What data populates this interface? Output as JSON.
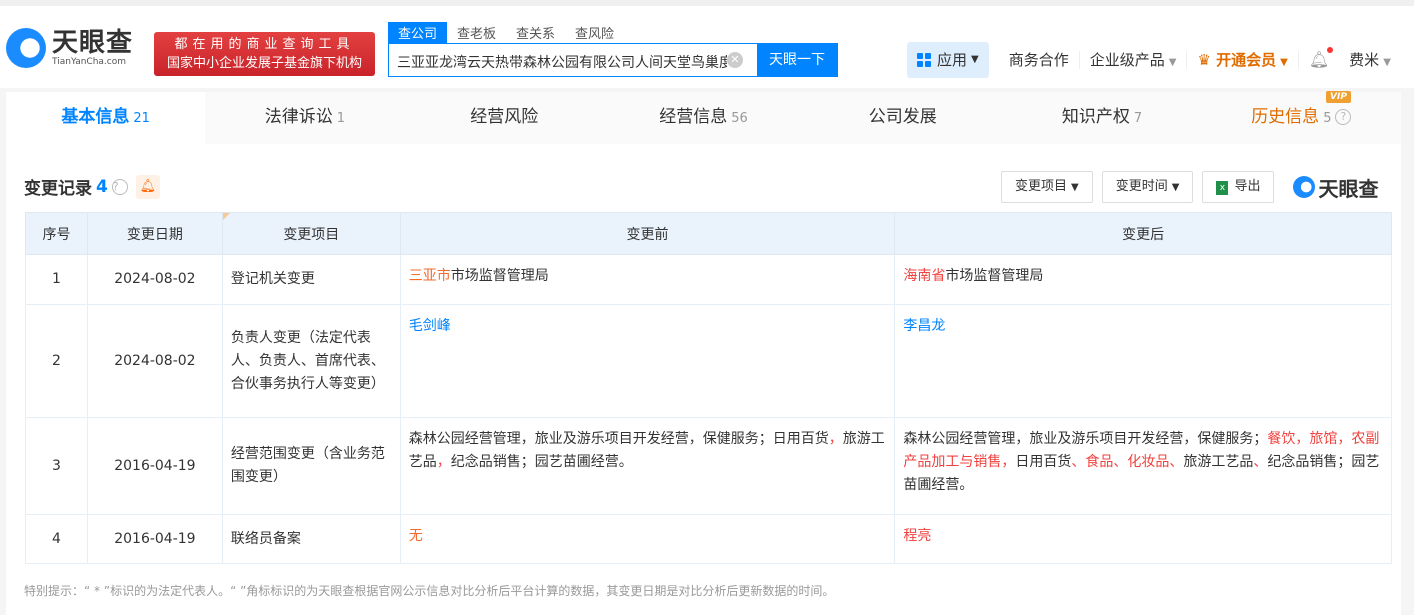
{
  "header": {
    "logo_text": "天眼查",
    "logo_domain": "TianYanCha.com",
    "slogan_line1": "都在用的商业查询工具",
    "slogan_line2": "国家中小企业发展子基金旗下机构",
    "search_tabs": [
      "查公司",
      "查老板",
      "查关系",
      "查风险"
    ],
    "search_value": "三亚亚龙湾云天热带森林公园有限公司人间天堂鸟巢度",
    "search_button": "天眼一下",
    "nav": {
      "app": "应用",
      "business": "商务合作",
      "enterprise": "企业级产品",
      "vip": "开通会员",
      "user": "费米"
    }
  },
  "tabs": [
    {
      "label": "基本信息",
      "count": "21"
    },
    {
      "label": "法律诉讼",
      "count": "1"
    },
    {
      "label": "经营风险",
      "count": ""
    },
    {
      "label": "经营信息",
      "count": "56"
    },
    {
      "label": "公司发展",
      "count": ""
    },
    {
      "label": "知识产权",
      "count": "7"
    },
    {
      "label": "历史信息",
      "count": "5",
      "badge": "VIP"
    }
  ],
  "section": {
    "title": "变更记录",
    "count": "4",
    "filter_item": "变更项目",
    "filter_time": "变更时间",
    "export": "导出",
    "brand": "天眼查"
  },
  "table": {
    "headers": [
      "序号",
      "变更日期",
      "变更项目",
      "变更前",
      "变更后"
    ],
    "rows": [
      {
        "no": "1",
        "date": "2024-08-02",
        "item": "登记机关变更",
        "before": [
          {
            "t": "三亚市",
            "c": "orange"
          },
          {
            "t": "市场监督管理局"
          }
        ],
        "after": [
          {
            "t": "海南省",
            "c": "red"
          },
          {
            "t": "市场监督管理局"
          }
        ]
      },
      {
        "no": "2",
        "date": "2024-08-02",
        "item": "负责人变更（法定代表人、负责人、首席代表、合伙事务执行人等变更）",
        "before": [
          {
            "t": "毛剑峰",
            "c": "blue"
          }
        ],
        "after": [
          {
            "t": "李昌龙",
            "c": "blue"
          }
        ]
      },
      {
        "no": "3",
        "date": "2016-04-19",
        "item": "经营范围变更（含业务范围变更）",
        "before": [
          {
            "t": "森林公园经营管理，旅业及游乐项目开发经营，保健服务；日用百货"
          },
          {
            "t": "，",
            "c": "red"
          },
          {
            "t": "旅游工艺品"
          },
          {
            "t": "，",
            "c": "red"
          },
          {
            "t": "纪念品销售；园艺苗圃经营。"
          }
        ],
        "after": [
          {
            "t": "森林公园经营管理，旅业及游乐项目开发经营，保健服务；"
          },
          {
            "t": "餐饮，旅馆，农副产品加工与销售，",
            "c": "red"
          },
          {
            "t": "日用百货"
          },
          {
            "t": "、食品、化妆品、",
            "c": "red"
          },
          {
            "t": "旅游工艺品"
          },
          {
            "t": "、",
            "c": "red"
          },
          {
            "t": "纪念品销售；园艺苗圃经营。"
          }
        ]
      },
      {
        "no": "4",
        "date": "2016-04-19",
        "item": "联络员备案",
        "before": [
          {
            "t": "无",
            "c": "orange"
          }
        ],
        "after": [
          {
            "t": "程亮",
            "c": "red"
          }
        ]
      }
    ]
  },
  "note": "特别提示：“ * ”标识的为法定代表人。“ ”角标标识的为天眼查根据官网公示信息对比分析后平台计算的数据，其变更日期是对比分析后更新数据的时间。"
}
